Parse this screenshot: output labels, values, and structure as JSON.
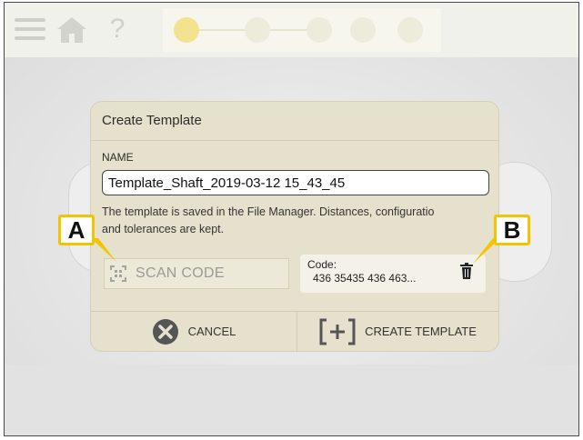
{
  "topbar": {
    "icons": [
      "menu-icon",
      "home-icon",
      "help-icon",
      "steps-progress"
    ],
    "help_glyph": "?"
  },
  "dialog": {
    "title": "Create Template",
    "name_label": "NAME",
    "name_value": "Template_Shaft_2019-03-12 15_43_45",
    "info_line1": "The template is saved in the File Manager. Distances, configuratio",
    "info_line2": "and tolerances are kept.",
    "scan_button_label": "SCAN CODE",
    "code_label": "Code:",
    "code_value": "436 35435 436 463...",
    "cancel_label": "CANCEL",
    "create_label": "CREATE TEMPLATE"
  },
  "callouts": {
    "a": "A",
    "b": "B"
  },
  "colors": {
    "dialog_bg": "#e6e1cd",
    "callout_border": "#f4c400",
    "cancel_circle": "#555555"
  }
}
